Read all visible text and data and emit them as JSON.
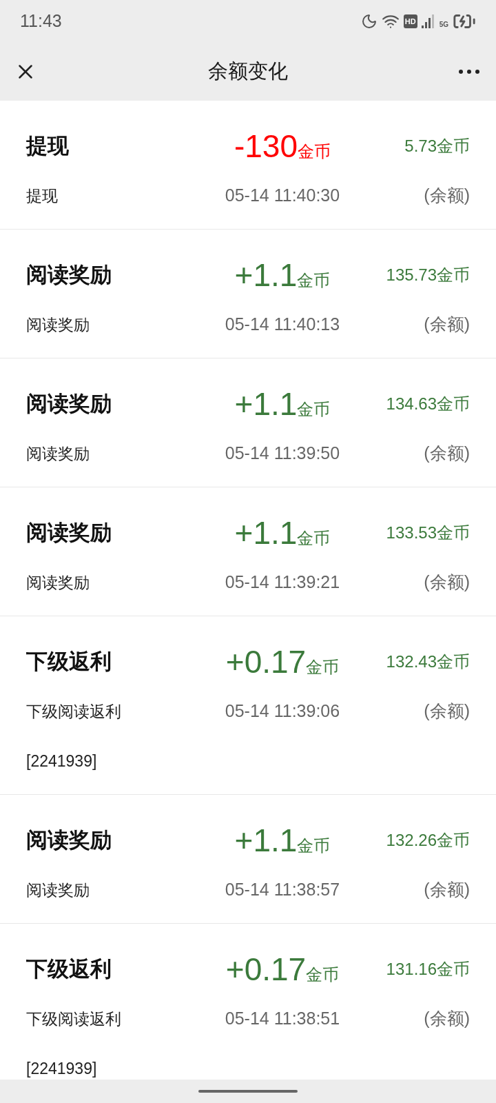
{
  "status_bar": {
    "time": "11:43",
    "hd_badge": "HD",
    "network": "5G"
  },
  "nav": {
    "title": "余额变化"
  },
  "records": [
    {
      "title": "提现",
      "description": "提现",
      "amount": "-130",
      "unit": "金币",
      "color": "#ff0000",
      "time": "05-14 11:40:30",
      "balance": "5.73金币",
      "balance_label": "(余额)"
    },
    {
      "title": "阅读奖励",
      "description": "阅读奖励",
      "amount": "+1.1",
      "unit": "金币",
      "color": "#3b7a3b",
      "time": "05-14 11:40:13",
      "balance": "135.73金币",
      "balance_label": "(余额)"
    },
    {
      "title": "阅读奖励",
      "description": "阅读奖励",
      "amount": "+1.1",
      "unit": "金币",
      "color": "#3b7a3b",
      "time": "05-14 11:39:50",
      "balance": "134.63金币",
      "balance_label": "(余额)"
    },
    {
      "title": "阅读奖励",
      "description": "阅读奖励",
      "amount": "+1.1",
      "unit": "金币",
      "color": "#3b7a3b",
      "time": "05-14 11:39:21",
      "balance": "133.53金币",
      "balance_label": "(余额)"
    },
    {
      "title": "下级返利",
      "description": "下级阅读返利 [2241939]",
      "amount": "+0.17",
      "unit": "金币",
      "color": "#3b7a3b",
      "time": "05-14 11:39:06",
      "balance": "132.43金币",
      "balance_label": "(余额)"
    },
    {
      "title": "阅读奖励",
      "description": "阅读奖励",
      "amount": "+1.1",
      "unit": "金币",
      "color": "#3b7a3b",
      "time": "05-14 11:38:57",
      "balance": "132.26金币",
      "balance_label": "(余额)"
    },
    {
      "title": "下级返利",
      "description": "下级阅读返利 [2241939]",
      "amount": "+0.17",
      "unit": "金币",
      "color": "#3b7a3b",
      "time": "05-14 11:38:51",
      "balance": "131.16金币",
      "balance_label": "(余额)"
    }
  ]
}
